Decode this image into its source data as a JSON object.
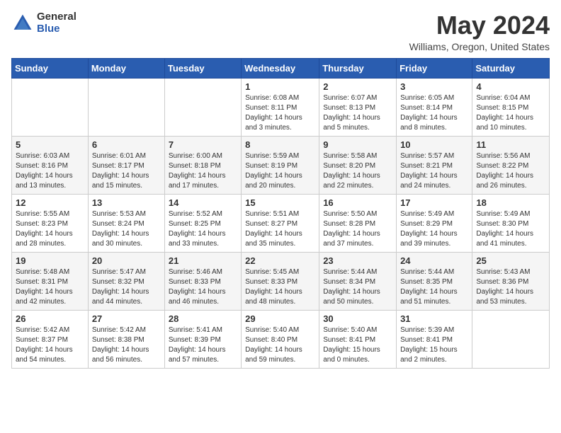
{
  "logo": {
    "general": "General",
    "blue": "Blue"
  },
  "header": {
    "month": "May 2024",
    "location": "Williams, Oregon, United States"
  },
  "weekdays": [
    "Sunday",
    "Monday",
    "Tuesday",
    "Wednesday",
    "Thursday",
    "Friday",
    "Saturday"
  ],
  "weeks": [
    [
      {
        "day": "",
        "sunrise": "",
        "sunset": "",
        "daylight": ""
      },
      {
        "day": "",
        "sunrise": "",
        "sunset": "",
        "daylight": ""
      },
      {
        "day": "",
        "sunrise": "",
        "sunset": "",
        "daylight": ""
      },
      {
        "day": "1",
        "sunrise": "Sunrise: 6:08 AM",
        "sunset": "Sunset: 8:11 PM",
        "daylight": "Daylight: 14 hours and 3 minutes."
      },
      {
        "day": "2",
        "sunrise": "Sunrise: 6:07 AM",
        "sunset": "Sunset: 8:13 PM",
        "daylight": "Daylight: 14 hours and 5 minutes."
      },
      {
        "day": "3",
        "sunrise": "Sunrise: 6:05 AM",
        "sunset": "Sunset: 8:14 PM",
        "daylight": "Daylight: 14 hours and 8 minutes."
      },
      {
        "day": "4",
        "sunrise": "Sunrise: 6:04 AM",
        "sunset": "Sunset: 8:15 PM",
        "daylight": "Daylight: 14 hours and 10 minutes."
      }
    ],
    [
      {
        "day": "5",
        "sunrise": "Sunrise: 6:03 AM",
        "sunset": "Sunset: 8:16 PM",
        "daylight": "Daylight: 14 hours and 13 minutes."
      },
      {
        "day": "6",
        "sunrise": "Sunrise: 6:01 AM",
        "sunset": "Sunset: 8:17 PM",
        "daylight": "Daylight: 14 hours and 15 minutes."
      },
      {
        "day": "7",
        "sunrise": "Sunrise: 6:00 AM",
        "sunset": "Sunset: 8:18 PM",
        "daylight": "Daylight: 14 hours and 17 minutes."
      },
      {
        "day": "8",
        "sunrise": "Sunrise: 5:59 AM",
        "sunset": "Sunset: 8:19 PM",
        "daylight": "Daylight: 14 hours and 20 minutes."
      },
      {
        "day": "9",
        "sunrise": "Sunrise: 5:58 AM",
        "sunset": "Sunset: 8:20 PM",
        "daylight": "Daylight: 14 hours and 22 minutes."
      },
      {
        "day": "10",
        "sunrise": "Sunrise: 5:57 AM",
        "sunset": "Sunset: 8:21 PM",
        "daylight": "Daylight: 14 hours and 24 minutes."
      },
      {
        "day": "11",
        "sunrise": "Sunrise: 5:56 AM",
        "sunset": "Sunset: 8:22 PM",
        "daylight": "Daylight: 14 hours and 26 minutes."
      }
    ],
    [
      {
        "day": "12",
        "sunrise": "Sunrise: 5:55 AM",
        "sunset": "Sunset: 8:23 PM",
        "daylight": "Daylight: 14 hours and 28 minutes."
      },
      {
        "day": "13",
        "sunrise": "Sunrise: 5:53 AM",
        "sunset": "Sunset: 8:24 PM",
        "daylight": "Daylight: 14 hours and 30 minutes."
      },
      {
        "day": "14",
        "sunrise": "Sunrise: 5:52 AM",
        "sunset": "Sunset: 8:25 PM",
        "daylight": "Daylight: 14 hours and 33 minutes."
      },
      {
        "day": "15",
        "sunrise": "Sunrise: 5:51 AM",
        "sunset": "Sunset: 8:27 PM",
        "daylight": "Daylight: 14 hours and 35 minutes."
      },
      {
        "day": "16",
        "sunrise": "Sunrise: 5:50 AM",
        "sunset": "Sunset: 8:28 PM",
        "daylight": "Daylight: 14 hours and 37 minutes."
      },
      {
        "day": "17",
        "sunrise": "Sunrise: 5:49 AM",
        "sunset": "Sunset: 8:29 PM",
        "daylight": "Daylight: 14 hours and 39 minutes."
      },
      {
        "day": "18",
        "sunrise": "Sunrise: 5:49 AM",
        "sunset": "Sunset: 8:30 PM",
        "daylight": "Daylight: 14 hours and 41 minutes."
      }
    ],
    [
      {
        "day": "19",
        "sunrise": "Sunrise: 5:48 AM",
        "sunset": "Sunset: 8:31 PM",
        "daylight": "Daylight: 14 hours and 42 minutes."
      },
      {
        "day": "20",
        "sunrise": "Sunrise: 5:47 AM",
        "sunset": "Sunset: 8:32 PM",
        "daylight": "Daylight: 14 hours and 44 minutes."
      },
      {
        "day": "21",
        "sunrise": "Sunrise: 5:46 AM",
        "sunset": "Sunset: 8:33 PM",
        "daylight": "Daylight: 14 hours and 46 minutes."
      },
      {
        "day": "22",
        "sunrise": "Sunrise: 5:45 AM",
        "sunset": "Sunset: 8:33 PM",
        "daylight": "Daylight: 14 hours and 48 minutes."
      },
      {
        "day": "23",
        "sunrise": "Sunrise: 5:44 AM",
        "sunset": "Sunset: 8:34 PM",
        "daylight": "Daylight: 14 hours and 50 minutes."
      },
      {
        "day": "24",
        "sunrise": "Sunrise: 5:44 AM",
        "sunset": "Sunset: 8:35 PM",
        "daylight": "Daylight: 14 hours and 51 minutes."
      },
      {
        "day": "25",
        "sunrise": "Sunrise: 5:43 AM",
        "sunset": "Sunset: 8:36 PM",
        "daylight": "Daylight: 14 hours and 53 minutes."
      }
    ],
    [
      {
        "day": "26",
        "sunrise": "Sunrise: 5:42 AM",
        "sunset": "Sunset: 8:37 PM",
        "daylight": "Daylight: 14 hours and 54 minutes."
      },
      {
        "day": "27",
        "sunrise": "Sunrise: 5:42 AM",
        "sunset": "Sunset: 8:38 PM",
        "daylight": "Daylight: 14 hours and 56 minutes."
      },
      {
        "day": "28",
        "sunrise": "Sunrise: 5:41 AM",
        "sunset": "Sunset: 8:39 PM",
        "daylight": "Daylight: 14 hours and 57 minutes."
      },
      {
        "day": "29",
        "sunrise": "Sunrise: 5:40 AM",
        "sunset": "Sunset: 8:40 PM",
        "daylight": "Daylight: 14 hours and 59 minutes."
      },
      {
        "day": "30",
        "sunrise": "Sunrise: 5:40 AM",
        "sunset": "Sunset: 8:41 PM",
        "daylight": "Daylight: 15 hours and 0 minutes."
      },
      {
        "day": "31",
        "sunrise": "Sunrise: 5:39 AM",
        "sunset": "Sunset: 8:41 PM",
        "daylight": "Daylight: 15 hours and 2 minutes."
      },
      {
        "day": "",
        "sunrise": "",
        "sunset": "",
        "daylight": ""
      }
    ]
  ]
}
